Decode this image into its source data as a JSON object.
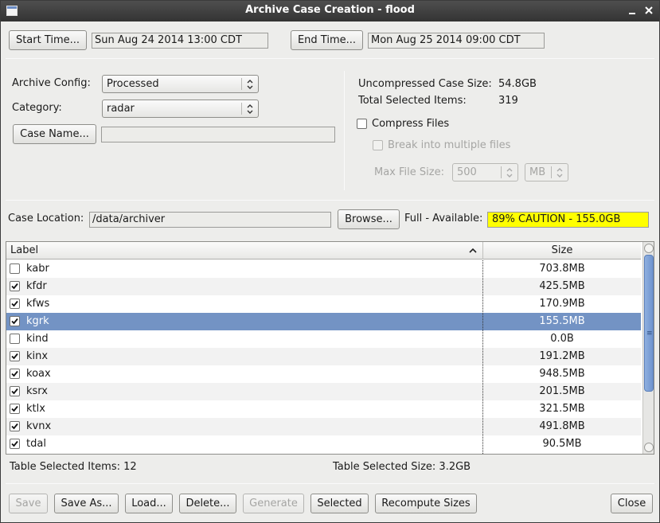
{
  "window": {
    "title": "Archive Case Creation - flood"
  },
  "time": {
    "start_button": "Start Time...",
    "start_value": "Sun Aug 24 2014 13:00 CDT",
    "end_button": "End Time...",
    "end_value": "Mon Aug 25 2014 09:00 CDT"
  },
  "config": {
    "archive_config_label": "Archive Config:",
    "archive_config_value": "Processed",
    "category_label": "Category:",
    "category_value": "radar",
    "case_name_button": "Case Name...",
    "case_name_value": ""
  },
  "summary": {
    "uncompressed_label": "Uncompressed Case Size:",
    "uncompressed_value": "54.8GB",
    "total_selected_label": "Total Selected Items:",
    "total_selected_value": "319",
    "compress_label": "Compress Files",
    "compress_checked": false,
    "break_label": "Break into multiple files",
    "max_file_size_label": "Max File Size:",
    "max_file_size_value": "500",
    "max_file_size_unit": "MB"
  },
  "location": {
    "label": "Case Location:",
    "value": "/data/archiver",
    "browse_button": "Browse...",
    "full_label": "Full - Available:",
    "full_value": "89% CAUTION - 155.0GB",
    "full_color": "#ffff00"
  },
  "table": {
    "columns": [
      "Label",
      "Size"
    ],
    "rows": [
      {
        "label": "kabr",
        "size": "703.8MB",
        "checked": false,
        "selected": false
      },
      {
        "label": "kfdr",
        "size": "425.5MB",
        "checked": true,
        "selected": false
      },
      {
        "label": "kfws",
        "size": "170.9MB",
        "checked": true,
        "selected": false
      },
      {
        "label": "kgrk",
        "size": "155.5MB",
        "checked": true,
        "selected": true
      },
      {
        "label": "kind",
        "size": "0.0B",
        "checked": false,
        "selected": false
      },
      {
        "label": "kinx",
        "size": "191.2MB",
        "checked": true,
        "selected": false
      },
      {
        "label": "koax",
        "size": "948.5MB",
        "checked": true,
        "selected": false
      },
      {
        "label": "ksrx",
        "size": "201.5MB",
        "checked": true,
        "selected": false
      },
      {
        "label": "ktlx",
        "size": "321.5MB",
        "checked": true,
        "selected": false
      },
      {
        "label": "kvnx",
        "size": "491.8MB",
        "checked": true,
        "selected": false
      },
      {
        "label": "tdal",
        "size": "90.5MB",
        "checked": true,
        "selected": false
      }
    ],
    "selected_color": "#7393c4"
  },
  "table_status": {
    "selected_items": "Table Selected Items: 12",
    "selected_size": "Table Selected Size: 3.2GB"
  },
  "footer": {
    "save": "Save",
    "save_as": "Save As...",
    "load": "Load...",
    "delete": "Delete...",
    "generate": "Generate",
    "selected": "Selected",
    "recompute": "Recompute Sizes",
    "close": "Close"
  }
}
